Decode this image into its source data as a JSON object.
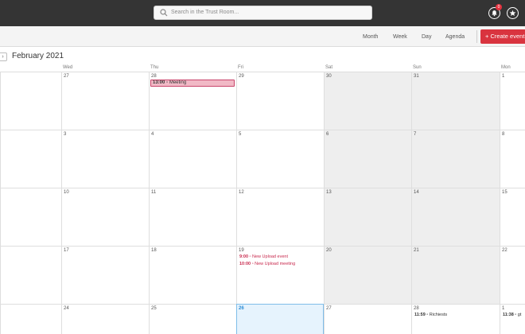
{
  "topbar": {
    "search_placeholder": "Search in the Trust Room...",
    "notification_count": "0"
  },
  "toolbar": {
    "views": [
      "Month",
      "Week",
      "Day",
      "Agenda"
    ],
    "create_label": "+ Create event"
  },
  "calendar": {
    "month_title": "February 2021",
    "weekdays": [
      "Wed",
      "Thu",
      "Fri",
      "Sat",
      "Sun",
      "Mon"
    ],
    "weeks": [
      [
        "27",
        "28",
        "29",
        "30",
        "31",
        "1"
      ],
      [
        "3",
        "4",
        "5",
        "6",
        "7",
        "8"
      ],
      [
        "10",
        "11",
        "12",
        "13",
        "14",
        "15"
      ],
      [
        "17",
        "18",
        "19",
        "20",
        "21",
        "22"
      ],
      [
        "24",
        "25",
        "26",
        "27",
        "28",
        "1"
      ]
    ],
    "events": [
      {
        "time": "13:00",
        "title": "Meeting"
      },
      {
        "time": "9:00",
        "title": "New Upload event"
      },
      {
        "time": "10:00",
        "title": "New Upload meeting"
      },
      {
        "time": "11:59",
        "title": "Richiests"
      },
      {
        "time": "11:38",
        "title": "gt"
      }
    ]
  },
  "colors": {
    "topbar": "#343434",
    "accent": "#d9343f",
    "event_text": "#c8294d",
    "event_fill": "#f1b9c6",
    "today_fill": "#e6f3fd",
    "weekend_fill": "#eeeeee"
  }
}
